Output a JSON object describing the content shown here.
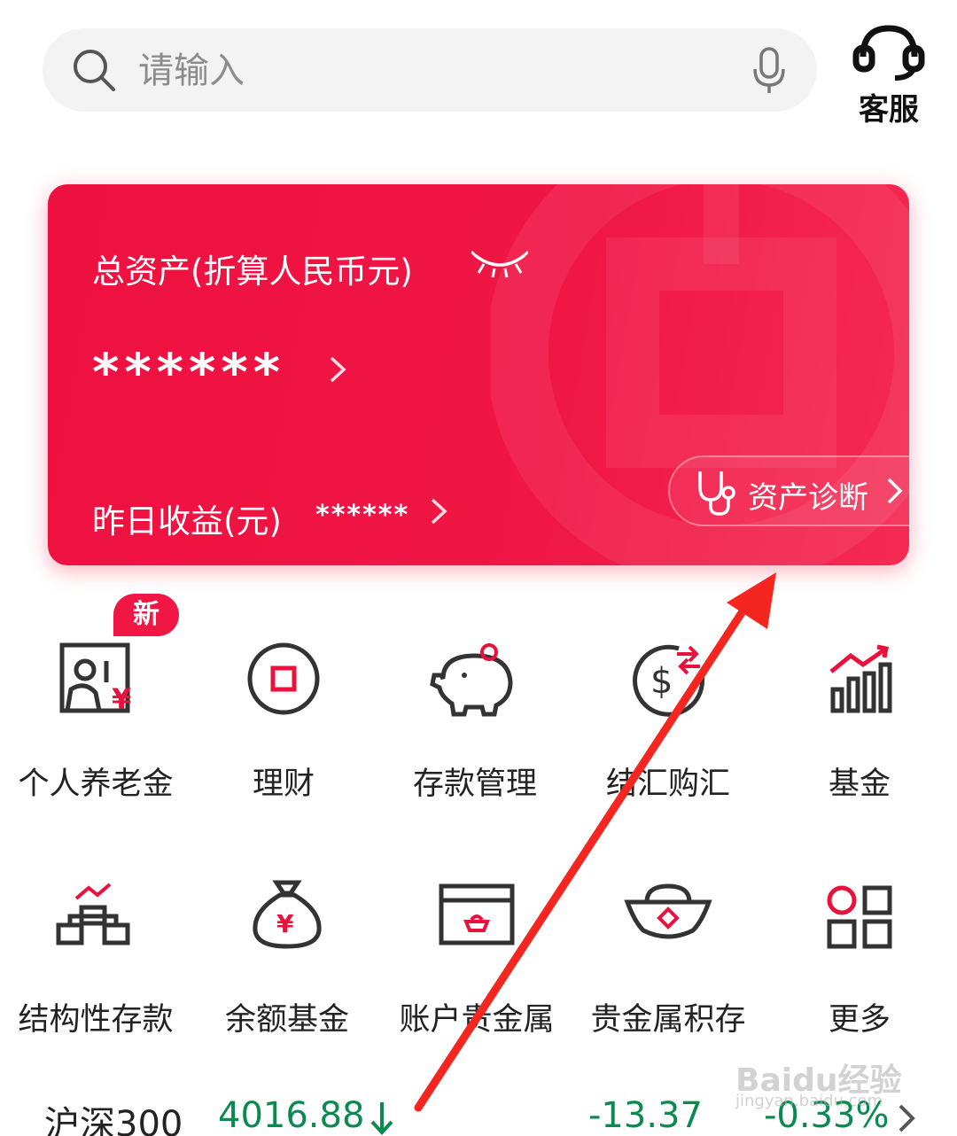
{
  "search": {
    "placeholder": "请输入"
  },
  "service": {
    "label": "客服"
  },
  "card": {
    "title": "总资产(折算人民币元)",
    "masked_total": "******",
    "income_label": "昨日收益(元)",
    "masked_income": "******",
    "diagnosis_label": "资产诊断"
  },
  "grid": [
    {
      "label": "个人养老金",
      "badge": "新",
      "icon": "pension-icon"
    },
    {
      "label": "理财",
      "icon": "wealth-icon"
    },
    {
      "label": "存款管理",
      "icon": "piggy-bank-icon"
    },
    {
      "label": "结汇购汇",
      "icon": "currency-exchange-icon"
    },
    {
      "label": "基金",
      "icon": "fund-chart-icon"
    },
    {
      "label": "结构性存款",
      "icon": "structured-deposit-icon"
    },
    {
      "label": "余额基金",
      "icon": "money-bag-icon"
    },
    {
      "label": "账户贵金属",
      "icon": "precious-metal-account-icon"
    },
    {
      "label": "贵金属积存",
      "icon": "gold-ingot-icon"
    },
    {
      "label": "更多",
      "icon": "more-apps-icon"
    }
  ],
  "ticker": {
    "name": "沪深300",
    "value": "4016.88",
    "change": "-13.37",
    "percent": "-0.33%"
  },
  "watermark": {
    "brand": "Baidu经验",
    "url": "jingyan.baidu.com"
  },
  "colors": {
    "brand_red": "#f01745",
    "down_green": "#0a8a50"
  }
}
